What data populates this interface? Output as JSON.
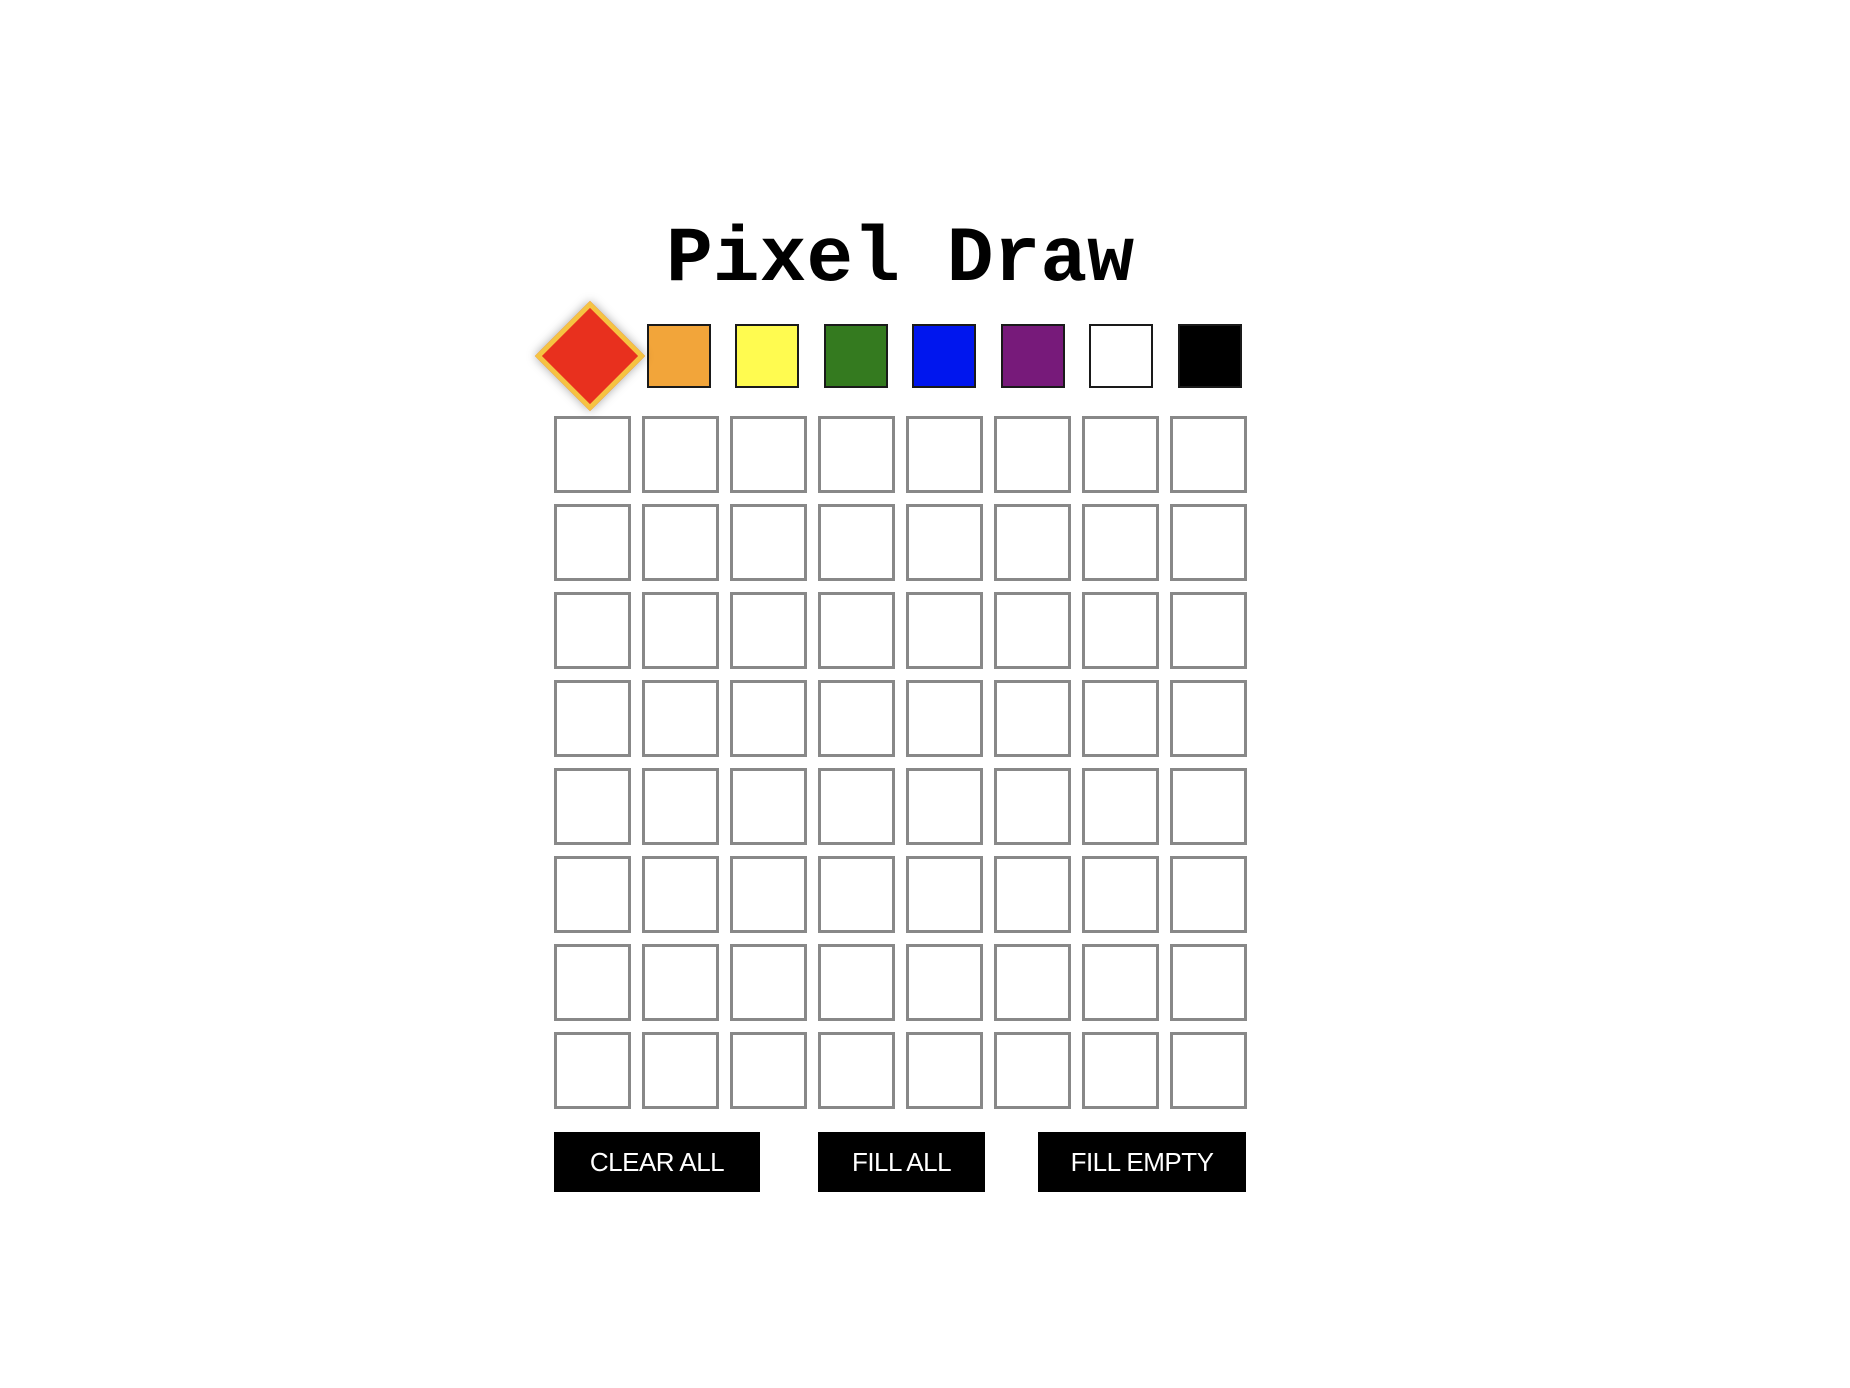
{
  "app": {
    "title": "Pixel Draw"
  },
  "palette": {
    "selected_index": 0,
    "colors": [
      {
        "name": "red",
        "hex": "#e8301e"
      },
      {
        "name": "orange",
        "hex": "#f2a53a"
      },
      {
        "name": "yellow",
        "hex": "#fffb50"
      },
      {
        "name": "green",
        "hex": "#347a1f"
      },
      {
        "name": "blue",
        "hex": "#0016ee"
      },
      {
        "name": "purple",
        "hex": "#771a7a"
      },
      {
        "name": "white",
        "hex": "#ffffff"
      },
      {
        "name": "black",
        "hex": "#000000"
      }
    ]
  },
  "grid": {
    "rows": 8,
    "cols": 8,
    "cells": [
      [
        "",
        "",
        "",
        "",
        "",
        "",
        "",
        ""
      ],
      [
        "",
        "",
        "",
        "",
        "",
        "",
        "",
        ""
      ],
      [
        "",
        "",
        "",
        "",
        "",
        "",
        "",
        ""
      ],
      [
        "",
        "",
        "",
        "",
        "",
        "",
        "",
        ""
      ],
      [
        "",
        "",
        "",
        "",
        "",
        "",
        "",
        ""
      ],
      [
        "",
        "",
        "",
        "",
        "",
        "",
        "",
        ""
      ],
      [
        "",
        "",
        "",
        "",
        "",
        "",
        "",
        ""
      ],
      [
        "",
        "",
        "",
        "",
        "",
        "",
        "",
        ""
      ]
    ],
    "empty_color": "#ffffff",
    "border_color": "#888888"
  },
  "buttons": {
    "clear_all": "CLEAR ALL",
    "fill_all": "FILL ALL",
    "fill_empty": "FILL EMPTY"
  }
}
